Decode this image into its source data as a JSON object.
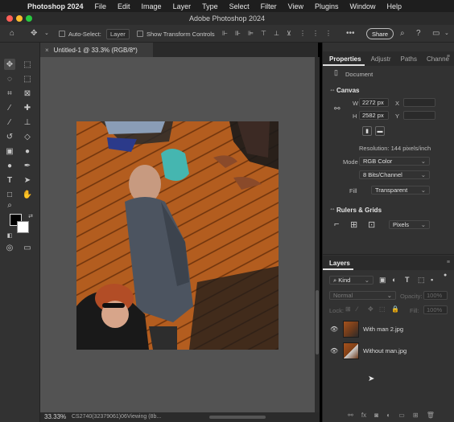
{
  "menubar": {
    "app": "Photoshop 2024",
    "menus": [
      "File",
      "Edit",
      "Image",
      "Layer",
      "Type",
      "Select",
      "Filter",
      "View",
      "Plugins",
      "Window",
      "Help"
    ]
  },
  "window": {
    "title": "Adobe Photoshop 2024"
  },
  "options_bar": {
    "auto_select_label": "Auto-Select:",
    "auto_select_value": "Layer",
    "show_transform_label": "Show Transform Controls",
    "share_label": "Share"
  },
  "document": {
    "tab_title": "Untitled-1 @ 33.3% (RGB/8*)",
    "close_glyph": "×"
  },
  "status": {
    "zoom": "33.33%",
    "info": "CS2740(32379061)06Viewing (8b..."
  },
  "properties": {
    "tabs": [
      "Properties",
      "Adjustr",
      "Paths",
      "Channe"
    ],
    "doc_label": "Document",
    "canvas": {
      "title": "Canvas",
      "w_label": "W",
      "w_value": "2272 px",
      "h_label": "H",
      "h_value": "2582 px",
      "x_label": "X",
      "y_label": "Y",
      "resolution": "Resolution: 144 pixels/inch",
      "mode_label": "Mode",
      "mode_value": "RGB Color",
      "bits_value": "8 Bits/Channel",
      "fill_label": "Fill",
      "fill_value": "Transparent"
    },
    "rulers": {
      "title": "Rulers & Grids",
      "units_value": "Pixels"
    }
  },
  "layers": {
    "tab": "Layers",
    "filter_value": "Kind",
    "blend_mode": "Normal",
    "opacity_label": "Opacity:",
    "opacity_value": "100%",
    "lock_label": "Lock:",
    "fill_label": "Fill:",
    "fill_value": "100%",
    "items": [
      {
        "name": "With man 2.jpg",
        "visible": true
      },
      {
        "name": "Without man.jpg",
        "visible": true
      }
    ]
  },
  "icons": {
    "move_tool": "move-icon",
    "home": "home-icon",
    "search": "search-icon",
    "help": "help-icon",
    "workspace": "workspace-icon",
    "eye": "eye-icon",
    "link": "link-icon"
  },
  "colors": {
    "foreground": "#000000",
    "background": "#ffffff",
    "canvas_bg": "#535353",
    "deck": "#b05a1e",
    "panel_bg": "#323232"
  }
}
